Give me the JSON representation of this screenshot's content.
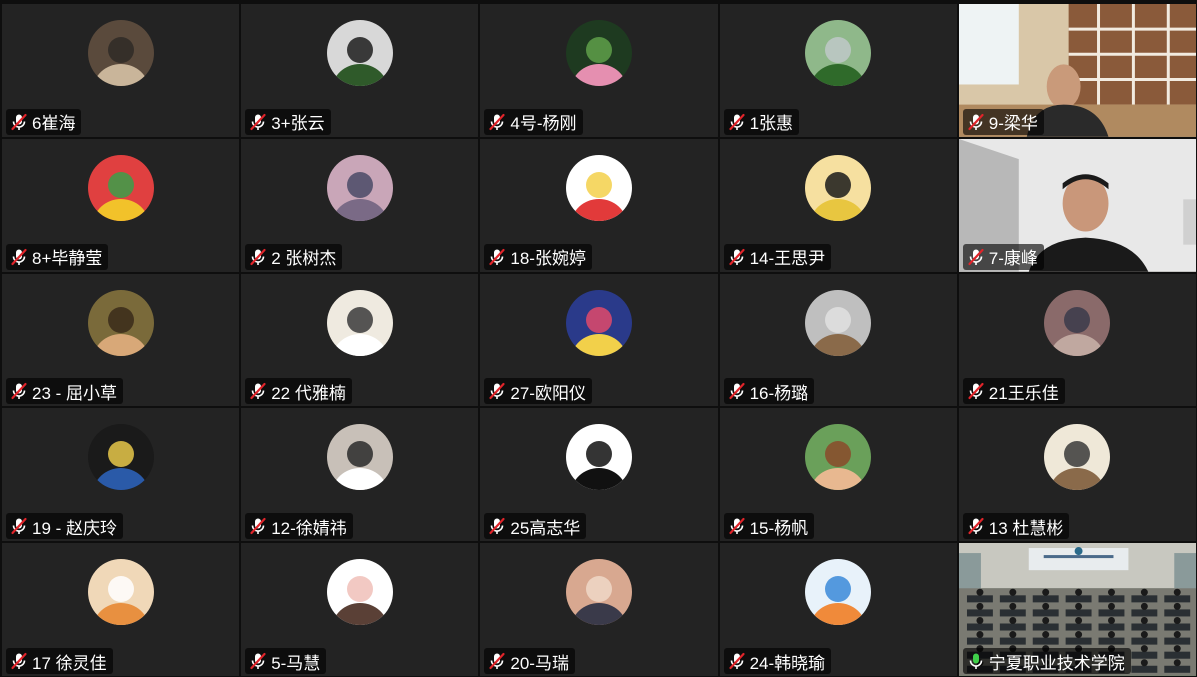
{
  "meeting": {
    "participants": [
      {
        "name": "6崔海",
        "mic": "muted",
        "avatar_icon": "library-portrait-avatar-icon",
        "avatar_colors": [
          "#5a4a3c",
          "#c9b59a",
          "#2f2a26"
        ]
      },
      {
        "name": "3+张云",
        "mic": "muted",
        "avatar_icon": "plant-avatar-icon",
        "avatar_colors": [
          "#d8d8d8",
          "#2f5a2a",
          "#1d1d1d"
        ]
      },
      {
        "name": "4号-杨刚",
        "mic": "muted",
        "avatar_icon": "lotus-avatar-icon",
        "avatar_colors": [
          "#1e3a20",
          "#e58fb0",
          "#5fa04a"
        ]
      },
      {
        "name": "1张惠",
        "mic": "muted",
        "avatar_icon": "garden-avatar-icon",
        "avatar_colors": [
          "#8fb88a",
          "#2f6a2a",
          "#c0c8c8"
        ]
      },
      {
        "name": "9-梁华",
        "mic": "muted",
        "video": "camera-bookshelf-room",
        "avatar_colors": [
          "#d9c7a8",
          "#8a5a3a",
          "#2a2a2a"
        ]
      },
      {
        "name": "8+毕静莹",
        "mic": "muted",
        "avatar_icon": "sunflower-avatar-icon",
        "avatar_colors": [
          "#e04040",
          "#f2c22a",
          "#3aa04a"
        ]
      },
      {
        "name": "2 张树杰",
        "mic": "muted",
        "avatar_icon": "misty-sea-avatar-icon",
        "avatar_colors": [
          "#c9a6b8",
          "#7a6a86",
          "#4a4a66"
        ]
      },
      {
        "name": "18-张婉婷",
        "mic": "muted",
        "avatar_icon": "cartoon-duck-avatar-icon",
        "avatar_colors": [
          "#ffffff",
          "#e23a3a",
          "#f3d04a"
        ]
      },
      {
        "name": "14-王思尹",
        "mic": "muted",
        "avatar_icon": "cartoon-cat-avatar-icon",
        "avatar_colors": [
          "#f6e0a0",
          "#e8c640",
          "#1a1a1a"
        ]
      },
      {
        "name": "7-康峰",
        "mic": "muted",
        "video": "camera-white-room",
        "avatar_colors": [
          "#e8e8e8",
          "#b8b8b8",
          "#1a1a1a"
        ]
      },
      {
        "name": "23 - 屈小草",
        "mic": "muted",
        "avatar_icon": "painting-portrait-avatar-icon",
        "avatar_colors": [
          "#7a6a3a",
          "#d8a878",
          "#3a2a1a"
        ]
      },
      {
        "name": "22 代雅楠",
        "mic": "muted",
        "avatar_icon": "moomin-avatar-icon",
        "avatar_colors": [
          "#efeae0",
          "#ffffff",
          "#3a3a3a"
        ]
      },
      {
        "name": "27-欧阳仪",
        "mic": "muted",
        "avatar_icon": "sailor-cat-avatar-icon",
        "avatar_colors": [
          "#2a3a8a",
          "#f2d04a",
          "#e04a6a"
        ]
      },
      {
        "name": "16-杨璐",
        "mic": "muted",
        "avatar_icon": "dog-photo-avatar-icon",
        "avatar_colors": [
          "#bfbfbf",
          "#8a6a4a",
          "#e0e0e0"
        ]
      },
      {
        "name": "21王乐佳",
        "mic": "muted",
        "avatar_icon": "street-photo-avatar-icon",
        "avatar_colors": [
          "#8a6a6a",
          "#c0a8a0",
          "#3a3a4a"
        ]
      },
      {
        "name": "19 - 赵庆玲",
        "mic": "muted",
        "avatar_icon": "pearl-earring-avatar-icon",
        "avatar_colors": [
          "#1a1a1a",
          "#2a5aa8",
          "#e8c84a"
        ]
      },
      {
        "name": "12-徐婧祎",
        "mic": "muted",
        "avatar_icon": "wedding-photo-avatar-icon",
        "avatar_colors": [
          "#c8c0b8",
          "#ffffff",
          "#2a2a2a"
        ]
      },
      {
        "name": "25高志华",
        "mic": "muted",
        "avatar_icon": "religious-symbols-avatar-icon",
        "avatar_colors": [
          "#ffffff",
          "#111111",
          "#111111"
        ]
      },
      {
        "name": "15-杨帆",
        "mic": "muted",
        "avatar_icon": "anime-girl-avatar-icon",
        "avatar_colors": [
          "#6aa05a",
          "#e8b890",
          "#8a4a2a"
        ]
      },
      {
        "name": "13 杜慧彬",
        "mic": "muted",
        "avatar_icon": "sketch-avatar-icon",
        "avatar_colors": [
          "#efe8d8",
          "#8a6a4a",
          "#3a3a3a"
        ]
      },
      {
        "name": "17 徐灵佳",
        "mic": "muted",
        "avatar_icon": "orange-cat-avatar-icon",
        "avatar_colors": [
          "#f0d8b8",
          "#e89040",
          "#ffffff"
        ]
      },
      {
        "name": "5-马慧",
        "mic": "muted",
        "avatar_icon": "cartoon-girl-avatar-icon",
        "avatar_colors": [
          "#ffffff",
          "#5a4036",
          "#f0c0b8"
        ]
      },
      {
        "name": "20-马瑞",
        "mic": "muted",
        "avatar_icon": "sunset-girl-avatar-icon",
        "avatar_colors": [
          "#d8a890",
          "#3a3a4a",
          "#f0d8c8"
        ]
      },
      {
        "name": "24-韩晓瑜",
        "mic": "muted",
        "avatar_icon": "tiger-costume-avatar-icon",
        "avatar_colors": [
          "#e8f2fa",
          "#f08a3a",
          "#3a8ad8"
        ]
      },
      {
        "name": "宁夏职业技术学院",
        "mic": "active",
        "video": "camera-classroom",
        "active_speaker": true,
        "avatar_colors": [
          "#6a7a6a",
          "#c8c8c0",
          "#2a3a3a"
        ]
      }
    ]
  }
}
